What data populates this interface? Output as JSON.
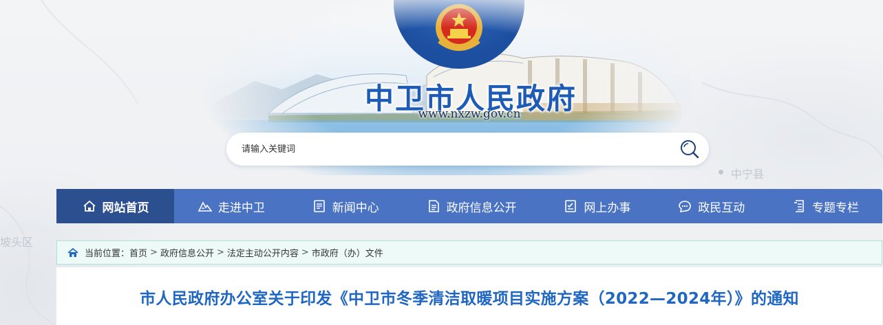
{
  "banner": {
    "title": "中卫市人民政府",
    "url": "www.nxzw.gov.cn"
  },
  "map_labels": {
    "zhongning": "中宁县",
    "potou": "坡头区"
  },
  "search": {
    "placeholder": "请输入关键词",
    "icon": "search-icon"
  },
  "nav": {
    "items": [
      {
        "label": "网站首页",
        "icon": "home-icon",
        "active": true
      },
      {
        "label": "走进中卫",
        "icon": "mountain-icon"
      },
      {
        "label": "新闻中心",
        "icon": "news-icon"
      },
      {
        "label": "政府信息公开",
        "icon": "document-icon"
      },
      {
        "label": "网上办事",
        "icon": "checklist-icon"
      },
      {
        "label": "政民互动",
        "icon": "chat-icon"
      },
      {
        "label": "专题专栏",
        "icon": "column-icon"
      }
    ]
  },
  "breadcrumb": {
    "prefix": "当前位置：",
    "items": [
      "首页",
      "政府信息公开",
      "法定主动公开内容",
      "市政府（办）文件"
    ],
    "separator": ">"
  },
  "article": {
    "title": "市人民政府办公室关于印发《中卫市冬季清洁取暖项目实施方案（2022—2024年）》的通知"
  },
  "colors": {
    "nav_bg": "#4a73c4",
    "nav_active": "#2c4f90",
    "title_blue": "#1f67c2",
    "crumb_bg": "#eefaf7"
  }
}
